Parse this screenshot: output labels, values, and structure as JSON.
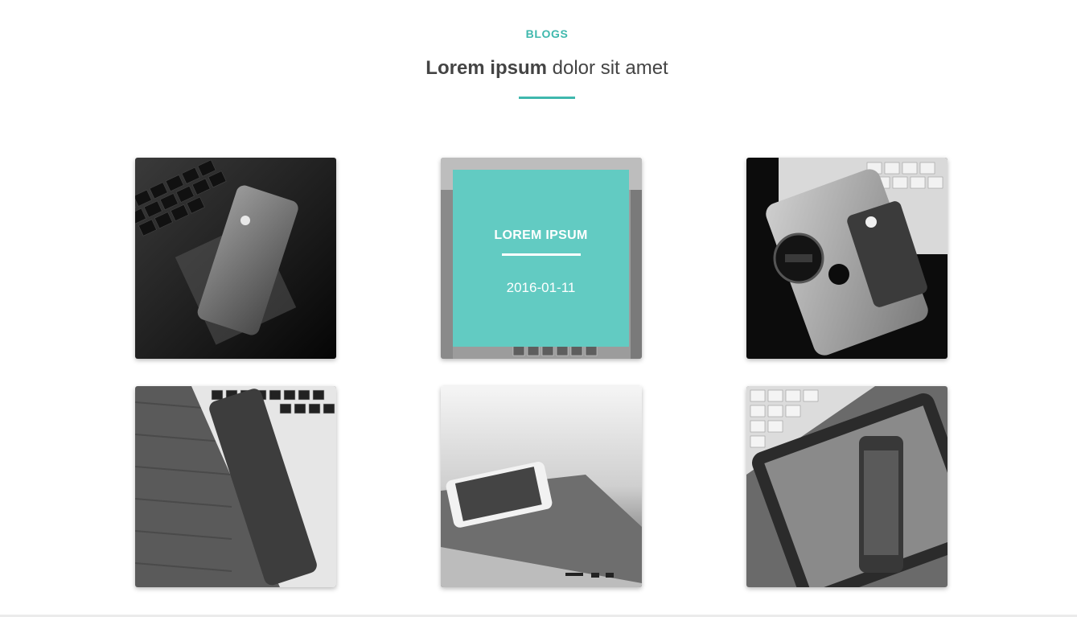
{
  "header": {
    "kicker": "BLOGS",
    "title_bold": "Lorem ipsum",
    "title_rest": " dolor sit amet"
  },
  "colors": {
    "accent": "#3fb8ad",
    "overlay": "#62cbc2",
    "heading": "#444444"
  },
  "blog_cards": [
    {
      "image": "iphone-on-laptop-dark-photo"
    },
    {
      "image": "laptop-keyboard-photo",
      "overlay_title": "LOREM IPSUM",
      "overlay_date": "2016-01-11"
    },
    {
      "image": "ipad-iphone-camera-lens-photo"
    },
    {
      "image": "phone-on-macbook-wood-desk-photo"
    },
    {
      "image": "iphone-on-macbook-air-photo"
    },
    {
      "image": "tablet-keyboard-phone-photo"
    }
  ]
}
